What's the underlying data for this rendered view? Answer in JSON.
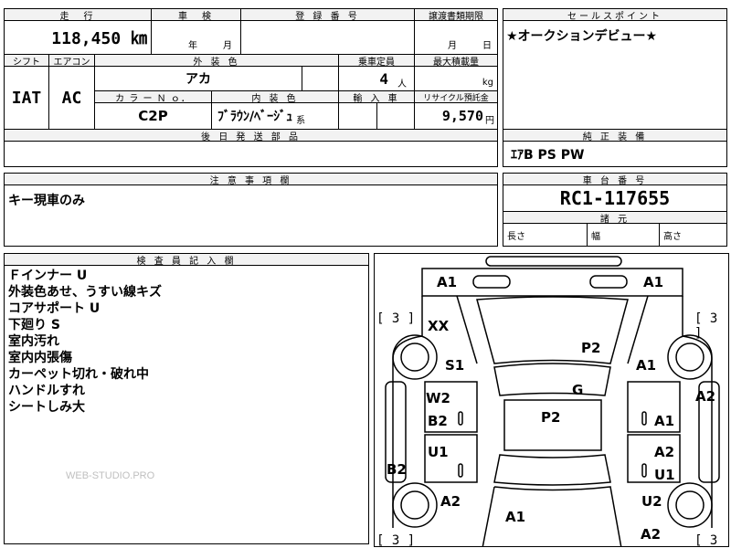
{
  "top": {
    "mileage_label": "走　行",
    "mileage": "118,450 ㎞",
    "inspection_label": "車　検",
    "inspection_year": "年",
    "inspection_month": "月",
    "registration_label": "登 録 番 号",
    "transfer_label": "譲渡書類期限",
    "transfer_month": "月",
    "transfer_day": "日",
    "shift_label": "シフト",
    "shift": "IAT",
    "ac_label": "エアコン",
    "ac": "AC",
    "ext_color_label": "外 装 色",
    "ext_color": "アカ",
    "seats_label": "乗車定員",
    "seats": "4",
    "seats_unit": "人",
    "capacity_label": "最大積載量",
    "capacity_unit": "kg",
    "color_no_label": "カ ラ ー Ｎ ｏ．",
    "color_no": "C2P",
    "interior_label": "内 装 色",
    "interior": "ﾌﾞﾗｳﾝ/ﾍﾞｰｼﾞｭ",
    "interior_suffix": "系",
    "import_label": "輸 入 車",
    "recycle_label": "リサイクル預託金",
    "recycle": "9,570",
    "recycle_unit": "円",
    "later_parts_label": "後 日 発 送 部 品"
  },
  "sales": {
    "label": "セールスポイント",
    "text": "★オークションデビュー★"
  },
  "options": {
    "label": "純 正 装 備",
    "text": "ｴｱB PS PW"
  },
  "caution": {
    "label": "注 意 事 項 欄",
    "text": "キー現車のみ"
  },
  "chassis": {
    "label": "車 台 番 号",
    "number": "RC1-117655",
    "dims_label": "諸 元",
    "length": "長さ",
    "width": "幅",
    "height": "高さ"
  },
  "inspector": {
    "label": "検 査 員 記 入 欄",
    "lines": [
      "Ｆインナー U",
      "外装色あせ、うすい線キズ",
      "コアサポート U",
      "下廻り S",
      "室内汚れ",
      "室内内張傷",
      "カーペット切れ・破れ中",
      "ハンドルすれ",
      "シートしみ大"
    ],
    "watermark": "WEB-STUDIO.PRO"
  },
  "diagram": {
    "tire_value": "3",
    "marks": {
      "front_left": "A1",
      "front_right": "A1",
      "fender_left_top": "XX",
      "hood": "P2",
      "fender_right": "A1",
      "fender_left": "S1",
      "roof_front": "G",
      "quarter_right": "A2",
      "door_left_front": "W2",
      "door_left_b2": "B2",
      "roof": "P2",
      "door_right_front": "A1",
      "door_left_rear": "U1",
      "door_right_rear": "A2",
      "rocker_left": "B2",
      "rocker_right": "U1",
      "rear_left": "A2",
      "rear_right": "U2",
      "bumper_rear": "A1",
      "rear_corner": "A2"
    }
  }
}
